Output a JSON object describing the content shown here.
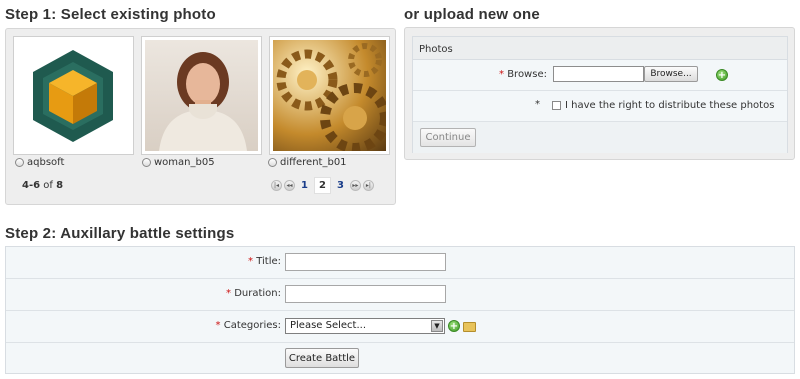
{
  "step1": {
    "heading": "Step 1: Select existing photo",
    "photos": [
      {
        "name": "aqbsoft",
        "icon": "aqbsoft-logo"
      },
      {
        "name": "woman_b05",
        "icon": "woman-portrait"
      },
      {
        "name": "different_b01",
        "icon": "gears-image"
      }
    ],
    "pager": {
      "range": "4-6",
      "of_label": "of",
      "total": "8",
      "pages": [
        "1",
        "2",
        "3"
      ],
      "current_page": "2"
    }
  },
  "upload": {
    "heading": "or upload new one",
    "panel_title": "Photos",
    "required_mark": "*",
    "browse_label": "Browse:",
    "browse_button": "Browse...",
    "rights_label": "I have the right to distribute these photos",
    "continue_button": "Continue"
  },
  "step2": {
    "heading": "Step 2: Auxillary battle settings",
    "required_mark": "*",
    "title_label": "Title:",
    "duration_label": "Duration:",
    "categories_label": "Categories:",
    "categories_selected": "Please Select...",
    "create_button": "Create Battle"
  },
  "colors": {
    "panel_bg": "#eeeeee",
    "form_bg": "#f3f7f9",
    "required": "#cc1111",
    "link": "#1a3d8a"
  }
}
